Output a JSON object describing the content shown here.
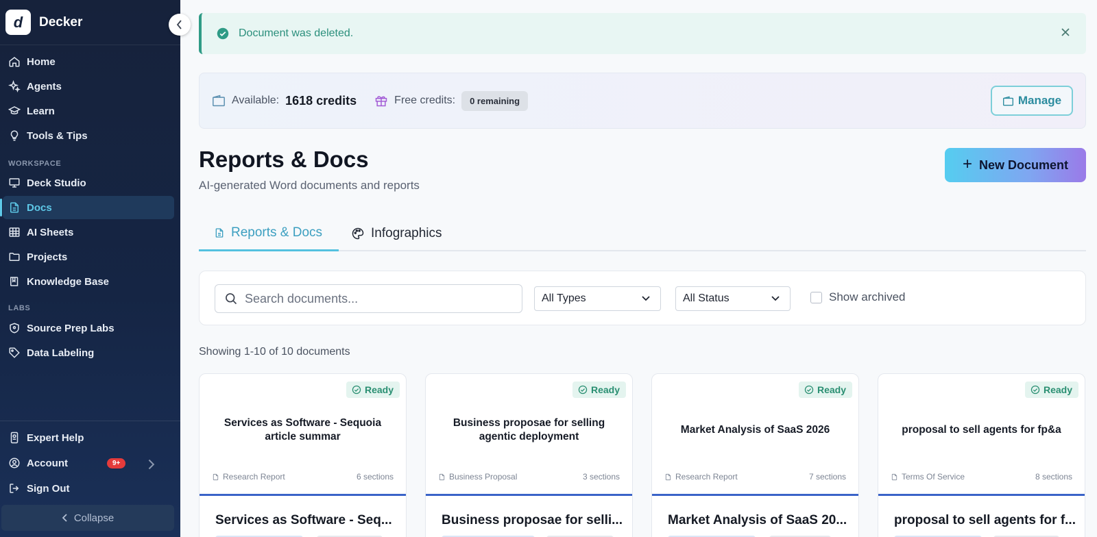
{
  "app": {
    "name": "Decker",
    "logo_letter": "d"
  },
  "nav": {
    "primary": [
      {
        "label": "Home",
        "icon": "home-icon"
      },
      {
        "label": "Agents",
        "icon": "sparkles-icon"
      },
      {
        "label": "Learn",
        "icon": "graduation-cap-icon"
      },
      {
        "label": "Tools & Tips",
        "icon": "lightbulb-icon"
      }
    ],
    "workspace_label": "WORKSPACE",
    "workspace": [
      {
        "label": "Deck Studio",
        "icon": "presentation-icon"
      },
      {
        "label": "Docs",
        "icon": "document-icon",
        "active": true
      },
      {
        "label": "AI Sheets",
        "icon": "table-icon"
      },
      {
        "label": "Projects",
        "icon": "folder-icon"
      },
      {
        "label": "Knowledge Base",
        "icon": "book-icon"
      }
    ],
    "labs_label": "LABS",
    "labs": [
      {
        "label": "Source Prep Labs",
        "icon": "shield-icon"
      },
      {
        "label": "Data Labeling",
        "icon": "tag-icon"
      }
    ],
    "bottom": [
      {
        "label": "Expert Help",
        "icon": "phone-icon"
      },
      {
        "label": "Account",
        "icon": "user-circle-icon",
        "badge": "9+"
      },
      {
        "label": "Sign Out",
        "icon": "logout-icon"
      }
    ],
    "collapse_label": "Collapse"
  },
  "toast": {
    "message": "Document was deleted."
  },
  "credits": {
    "available_label": "Available:",
    "available_value": "1618 credits",
    "free_label": "Free credits:",
    "free_value": "0 remaining",
    "manage_label": "Manage"
  },
  "page": {
    "title": "Reports & Docs",
    "subtitle": "AI-generated Word documents and reports",
    "new_button": "New Document"
  },
  "tabs": [
    {
      "label": "Reports & Docs",
      "active": true
    },
    {
      "label": "Infographics",
      "active": false
    }
  ],
  "filters": {
    "search_placeholder": "Search documents...",
    "type_select": "All Types",
    "status_select": "All Status",
    "archived_label": "Show archived"
  },
  "showing": "Showing 1-10 of 10 documents",
  "colors": {
    "accent": "#5ec9e8",
    "sidebar": "#16223b",
    "success": "#2a8f72",
    "card_bar": "#3a63c8"
  },
  "documents": [
    {
      "status": "Ready",
      "title": "Services as Software - Sequoia article summar",
      "type": "Research Report",
      "sections": "6 sections",
      "bottom_title": "Services as Software - Seq..."
    },
    {
      "status": "Ready",
      "title": "Business proposae for selling agentic deployment",
      "type": "Business Proposal",
      "sections": "3 sections",
      "bottom_title": "Business proposae for selli..."
    },
    {
      "status": "Ready",
      "title": "Market Analysis of SaaS 2026",
      "type": "Research Report",
      "sections": "7 sections",
      "bottom_title": "Market Analysis of SaaS 20..."
    },
    {
      "status": "Ready",
      "title": "proposal to sell agents for fp&a",
      "type": "Terms Of Service",
      "sections": "8 sections",
      "bottom_title": "proposal to sell agents for f..."
    }
  ]
}
